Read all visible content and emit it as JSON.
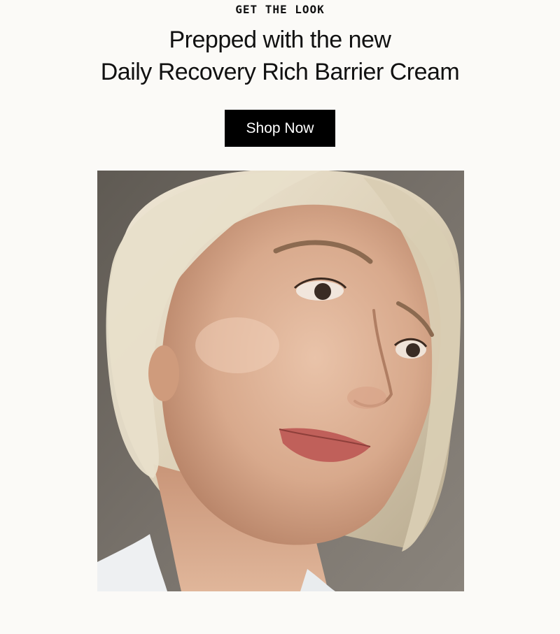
{
  "eyebrow": "GET THE LOOK",
  "headline": {
    "line1": "Prepped with the new",
    "line2": "Daily Recovery Rich Barrier Cream"
  },
  "cta": {
    "label": "Shop Now"
  },
  "photo": {
    "alt": "Portrait of a woman with a blonde bob looking to the side"
  },
  "colors": {
    "background": "#fbfaf7",
    "button": "#000000",
    "button_text": "#ffffff"
  }
}
